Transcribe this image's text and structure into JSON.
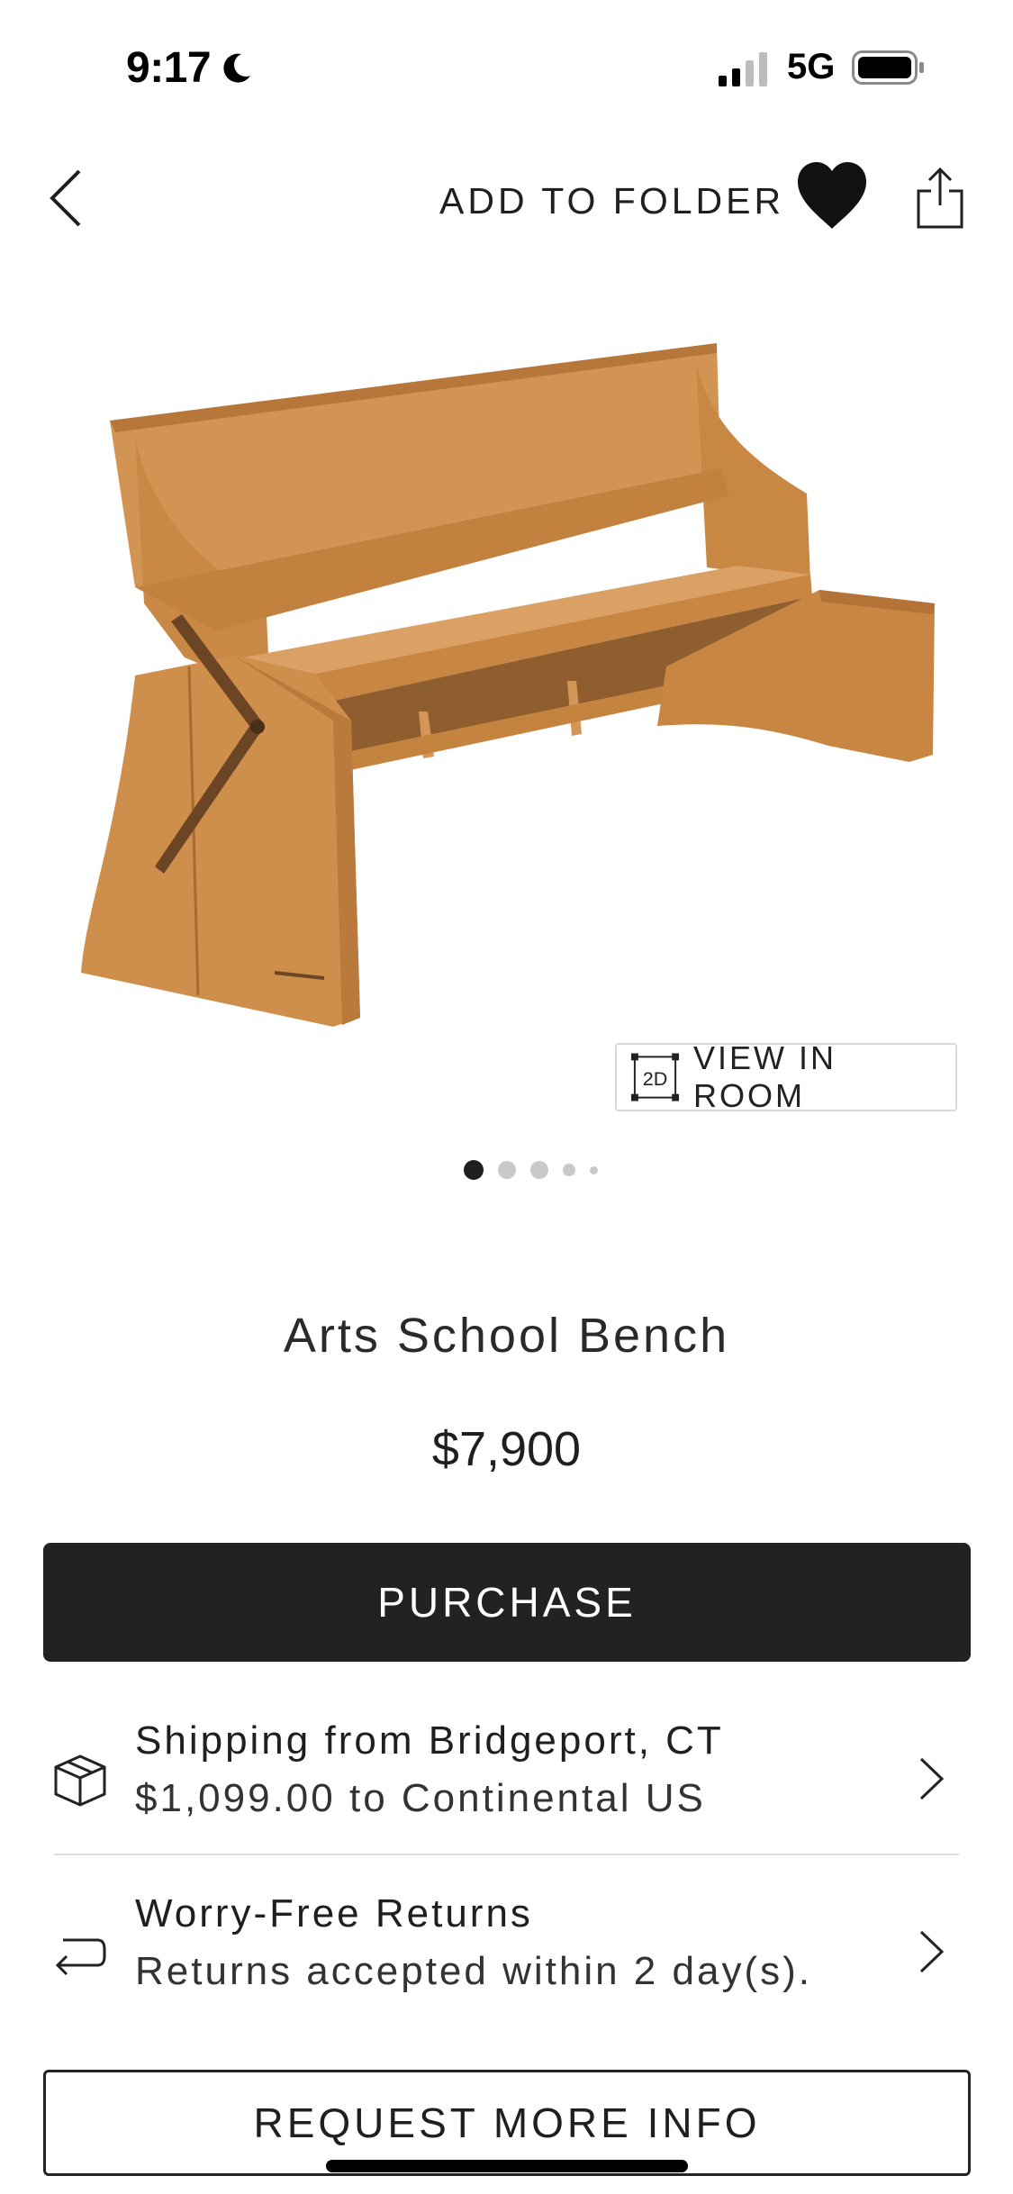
{
  "status_bar": {
    "time": "9:17",
    "network": "5G",
    "icons": [
      "moon-icon",
      "signal-icon",
      "battery-icon"
    ]
  },
  "nav": {
    "add_to_folder": "ADD TO FOLDER",
    "icons": [
      "back-chevron-icon",
      "heart-icon",
      "share-icon"
    ]
  },
  "gallery": {
    "view_in_room": "VIEW IN ROOM",
    "view_icon_text": "2D",
    "current_slide": 1,
    "slide_count": 5
  },
  "product": {
    "title": "Arts School Bench",
    "price": "$7,900"
  },
  "actions": {
    "purchase": "PURCHASE",
    "request_info": "REQUEST MORE INFO"
  },
  "shipping": {
    "line1": "Shipping from Bridgeport, CT",
    "line2": "$1,099.00 to Continental US",
    "icon": "box-icon"
  },
  "returns": {
    "line1": "Worry-Free Returns",
    "line2": "Returns accepted within 2 day(s).",
    "icon": "return-arrow-icon"
  },
  "colors": {
    "primary_button": "#222222",
    "text": "#1f1f1f",
    "divider": "#dcdcdc",
    "wood": "#c98a45"
  }
}
